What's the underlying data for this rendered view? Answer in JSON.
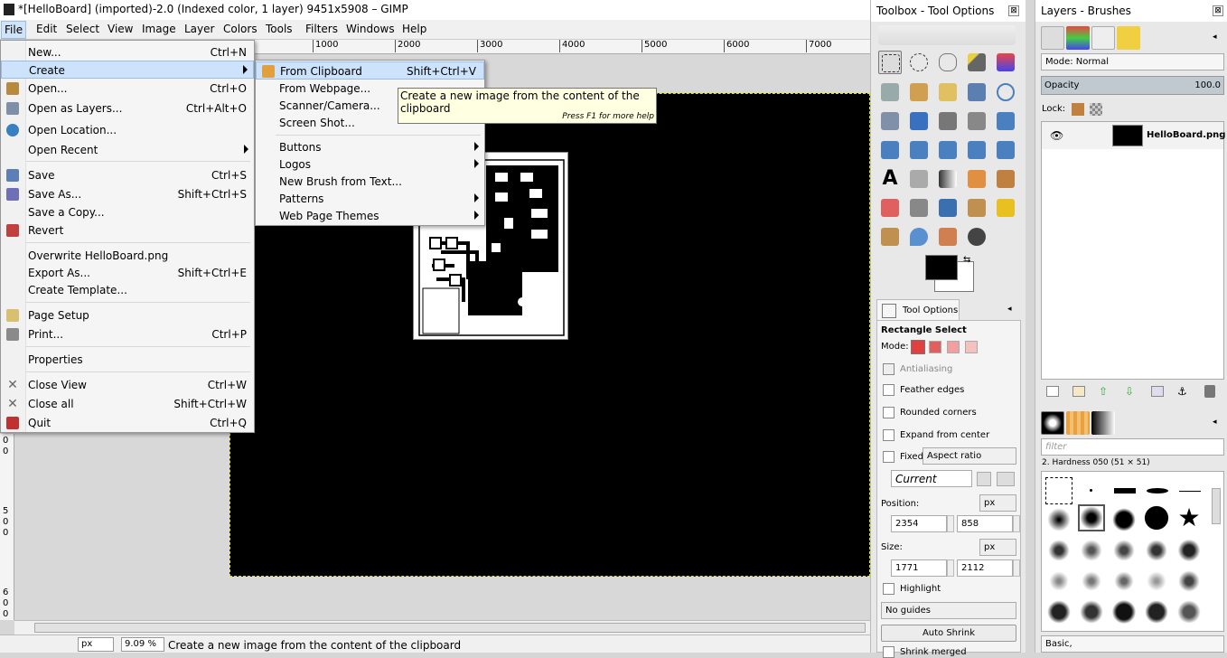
{
  "window": {
    "title": "*[HelloBoard] (imported)-2.0 (Indexed color, 1 layer) 9451x5908 – GIMP"
  },
  "menubar": {
    "items": [
      "File",
      "Edit",
      "Select",
      "View",
      "Image",
      "Layer",
      "Colors",
      "Tools",
      "Filters",
      "Windows",
      "Help"
    ]
  },
  "ruler": {
    "top_ticks": [
      "1000",
      "2000",
      "3000",
      "4000",
      "5000",
      "6000",
      "7000"
    ],
    "left_labels": [
      "0",
      "0",
      "5",
      "0",
      "0",
      "6",
      "0",
      "0"
    ]
  },
  "file_menu": {
    "items": [
      {
        "label": "New...",
        "accel": "Ctrl+N"
      },
      {
        "label": "Create",
        "accel": ""
      },
      {
        "label": "Open...",
        "accel": "Ctrl+O"
      },
      {
        "label": "Open as Layers...",
        "accel": "Ctrl+Alt+O"
      },
      {
        "label": "Open Location...",
        "accel": ""
      },
      {
        "label": "Open Recent",
        "accel": ""
      },
      {
        "label": "Save",
        "accel": "Ctrl+S"
      },
      {
        "label": "Save As...",
        "accel": "Shift+Ctrl+S"
      },
      {
        "label": "Save a Copy...",
        "accel": ""
      },
      {
        "label": "Revert",
        "accel": ""
      },
      {
        "label": "Overwrite HelloBoard.png",
        "accel": ""
      },
      {
        "label": "Export As...",
        "accel": "Shift+Ctrl+E"
      },
      {
        "label": "Create Template...",
        "accel": ""
      },
      {
        "label": "Page Setup",
        "accel": ""
      },
      {
        "label": "Print...",
        "accel": "Ctrl+P"
      },
      {
        "label": "Properties",
        "accel": ""
      },
      {
        "label": "Close View",
        "accel": "Ctrl+W"
      },
      {
        "label": "Close all",
        "accel": "Shift+Ctrl+W"
      },
      {
        "label": "Quit",
        "accel": "Ctrl+Q"
      }
    ]
  },
  "create_menu": {
    "items": [
      {
        "label": "From Clipboard",
        "accel": "Shift+Ctrl+V"
      },
      {
        "label": "From Webpage..."
      },
      {
        "label": "Scanner/Camera..."
      },
      {
        "label": "Screen Shot..."
      },
      {
        "label": "Buttons"
      },
      {
        "label": "Logos"
      },
      {
        "label": "New Brush from Text..."
      },
      {
        "label": "Patterns"
      },
      {
        "label": "Web Page Themes"
      }
    ]
  },
  "tooltip": {
    "text": "Create a new image from the content of the clipboard",
    "hint": "Press F1 for more help"
  },
  "statusbar": {
    "unit": "px",
    "zoom": "9.09 %",
    "message": "Create a new image from the content of the clipboard"
  },
  "toolbox": {
    "title": "Toolbox - Tool Options",
    "close": "⊠",
    "tool_options_tab": "Tool Options",
    "tool_name": "Rectangle Select",
    "mode_label": "Mode:",
    "antialiasing": "Antialiasing",
    "feather_edges": "Feather edges",
    "rounded_corners": "Rounded corners",
    "expand_from_center": "Expand from center",
    "fixed_label": "Fixed:",
    "fixed_value": "Aspect ratio",
    "current": "Current",
    "position_label": "Position:",
    "position_unit": "px",
    "pos_x": "2354",
    "pos_y": "858",
    "size_label": "Size:",
    "size_unit": "px",
    "size_w": "1771",
    "size_h": "2112",
    "highlight": "Highlight",
    "guides": "No guides",
    "auto_shrink": "Auto Shrink",
    "shrink_merged": "Shrink merged"
  },
  "layers": {
    "title": "Layers - Brushes",
    "mode_label": "Mode: Normal",
    "opacity_label": "Opacity",
    "opacity_value": "100.0",
    "lock_label": "Lock:",
    "layer_name": "HelloBoard.png",
    "filter_placeholder": "filter",
    "brush_name": "2. Hardness 050 (51 × 51)",
    "bottom_combo": "Basic,"
  },
  "colors": {
    "highlight": "#cde2fb",
    "tooltip_bg": "#ffffe1",
    "canvas": "#000000"
  }
}
